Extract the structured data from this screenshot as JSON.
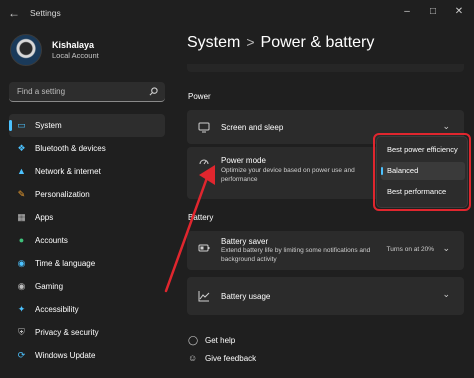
{
  "app": {
    "title": "Settings"
  },
  "user": {
    "name": "Kishalaya",
    "account": "Local Account"
  },
  "search": {
    "placeholder": "Find a setting"
  },
  "sidebar": {
    "items": [
      {
        "label": "System",
        "icon": "monitor-icon",
        "active": true
      },
      {
        "label": "Bluetooth & devices",
        "icon": "bluetooth-icon"
      },
      {
        "label": "Network & internet",
        "icon": "wifi-icon"
      },
      {
        "label": "Personalization",
        "icon": "brush-icon"
      },
      {
        "label": "Apps",
        "icon": "apps-icon"
      },
      {
        "label": "Accounts",
        "icon": "person-icon"
      },
      {
        "label": "Time & language",
        "icon": "globe-icon"
      },
      {
        "label": "Gaming",
        "icon": "gamepad-icon"
      },
      {
        "label": "Accessibility",
        "icon": "accessibility-icon"
      },
      {
        "label": "Privacy & security",
        "icon": "shield-icon"
      },
      {
        "label": "Windows Update",
        "icon": "update-icon"
      }
    ]
  },
  "breadcrumb": {
    "parent": "System",
    "separator": ">",
    "current": "Power & battery"
  },
  "main": {
    "power_heading": "Power",
    "screen_sleep": "Screen and sleep",
    "power_mode": {
      "title": "Power mode",
      "desc": "Optimize your device based on power use and performance"
    },
    "battery_heading": "Battery",
    "battery_saver": {
      "title": "Battery saver",
      "desc": "Extend battery life by limiting some notifications and background activity",
      "status": "Turns on at 20%"
    },
    "battery_usage": "Battery usage"
  },
  "dropdown": {
    "options": [
      "Best power efficiency",
      "Balanced",
      "Best performance"
    ],
    "selected": "Balanced"
  },
  "footer": {
    "help": "Get help",
    "feedback": "Give feedback"
  },
  "colors": {
    "accent": "#4cc2ff",
    "annotation": "#e0262e",
    "background": "#1f1f1f",
    "card": "#2b2b2b"
  }
}
